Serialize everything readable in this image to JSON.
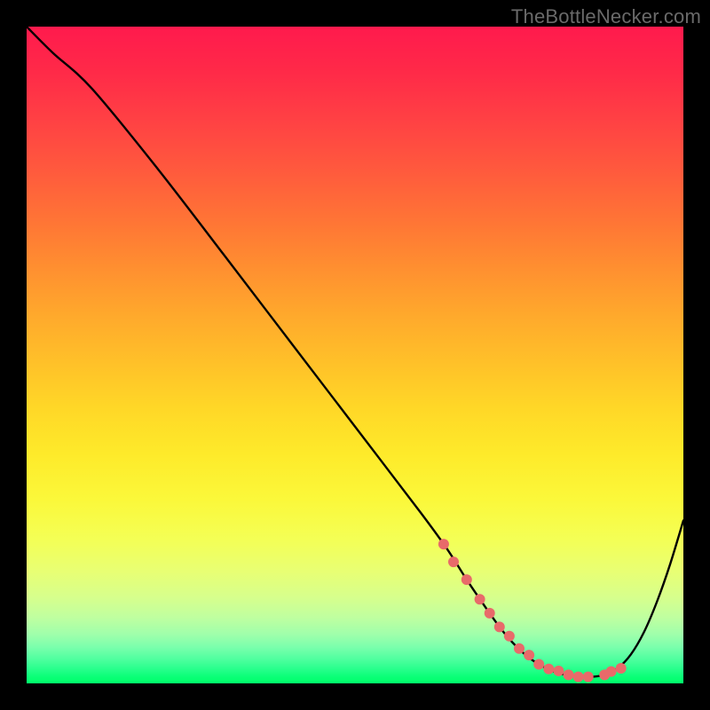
{
  "watermark": "TheBottleNecker.com",
  "chart_data": {
    "type": "line",
    "title": "",
    "xlabel": "",
    "ylabel": "",
    "xlim": [
      0,
      100
    ],
    "ylim": [
      0,
      100
    ],
    "series": [
      {
        "name": "curve",
        "x": [
          0,
          4,
          10,
          20,
          30,
          40,
          50,
          60,
          64,
          67,
          70,
          72,
          74,
          76,
          78,
          80,
          82,
          84,
          86,
          88,
          90,
          92,
          94,
          96,
          98,
          100
        ],
        "y": [
          100,
          96,
          90.5,
          78.3,
          65.3,
          52.2,
          39.1,
          26,
          20.5,
          15.8,
          11.4,
          8.6,
          6.2,
          4.3,
          2.9,
          1.9,
          1.3,
          1.0,
          1.0,
          1.3,
          2.3,
          4.4,
          7.8,
          12.5,
          18.2,
          24.8
        ]
      }
    ],
    "markers": {
      "x": [
        63.5,
        65,
        67,
        69,
        70.5,
        72,
        73.5,
        75,
        76.5,
        78,
        79.5,
        81,
        82.5,
        84,
        85.5,
        88,
        89,
        90.5
      ],
      "y": [
        21.2,
        18.5,
        15.8,
        12.8,
        10.7,
        8.6,
        7.2,
        5.3,
        4.3,
        2.9,
        2.2,
        1.9,
        1.3,
        1.0,
        1.0,
        1.3,
        1.8,
        2.3
      ],
      "color": "#e86a6a",
      "radius": 6
    }
  }
}
